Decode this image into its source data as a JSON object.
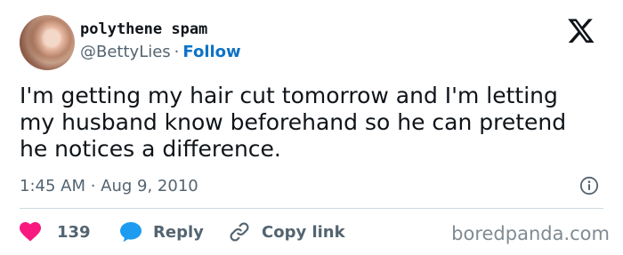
{
  "author": {
    "display_name": "polythene spam",
    "handle": "@BettyLies",
    "separator": "·",
    "follow_label": "Follow"
  },
  "tweet": {
    "text": "I'm getting my hair cut tomorrow and I'm letting my husband know beforehand so he can pretend he notices a difference.",
    "timestamp": "1:45 AM · Aug 9, 2010"
  },
  "actions": {
    "like_count": "139",
    "reply_label": "Reply",
    "copy_link_label": "Copy link"
  },
  "watermark": "boredpanda.com",
  "icons": {
    "platform": "x-logo-icon",
    "info": "info-icon",
    "like": "heart-icon",
    "reply": "speech-bubble-icon",
    "copy_link": "link-icon"
  },
  "colors": {
    "text": "#0f1419",
    "secondary": "#536471",
    "follow": "#0f73c6",
    "heart": "#f91880",
    "reply_bubble": "#1d9bf0",
    "divider": "#cfd9de"
  }
}
